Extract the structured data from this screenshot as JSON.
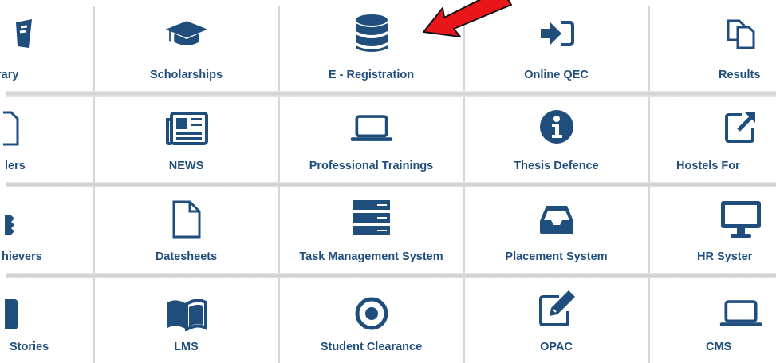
{
  "tiles": {
    "r1": [
      "rary",
      "Scholarships",
      "E - Registration",
      "Online QEC",
      "Results"
    ],
    "r2": [
      "lers",
      "NEWS",
      "Professional Trainings",
      "Thesis Defence",
      "Hostels For"
    ],
    "r3": [
      "hievers",
      "Datesheets",
      "Task Management System",
      "Placement System",
      "HR Syster"
    ],
    "r4": [
      "Stories",
      "LMS",
      "Student Clearance",
      "OPAC",
      "CMS"
    ]
  },
  "colors": {
    "icon": "#1f4e7c",
    "label": "#1f4e7c",
    "arrow": "#e8161b",
    "divider": "#d6d6d6"
  }
}
